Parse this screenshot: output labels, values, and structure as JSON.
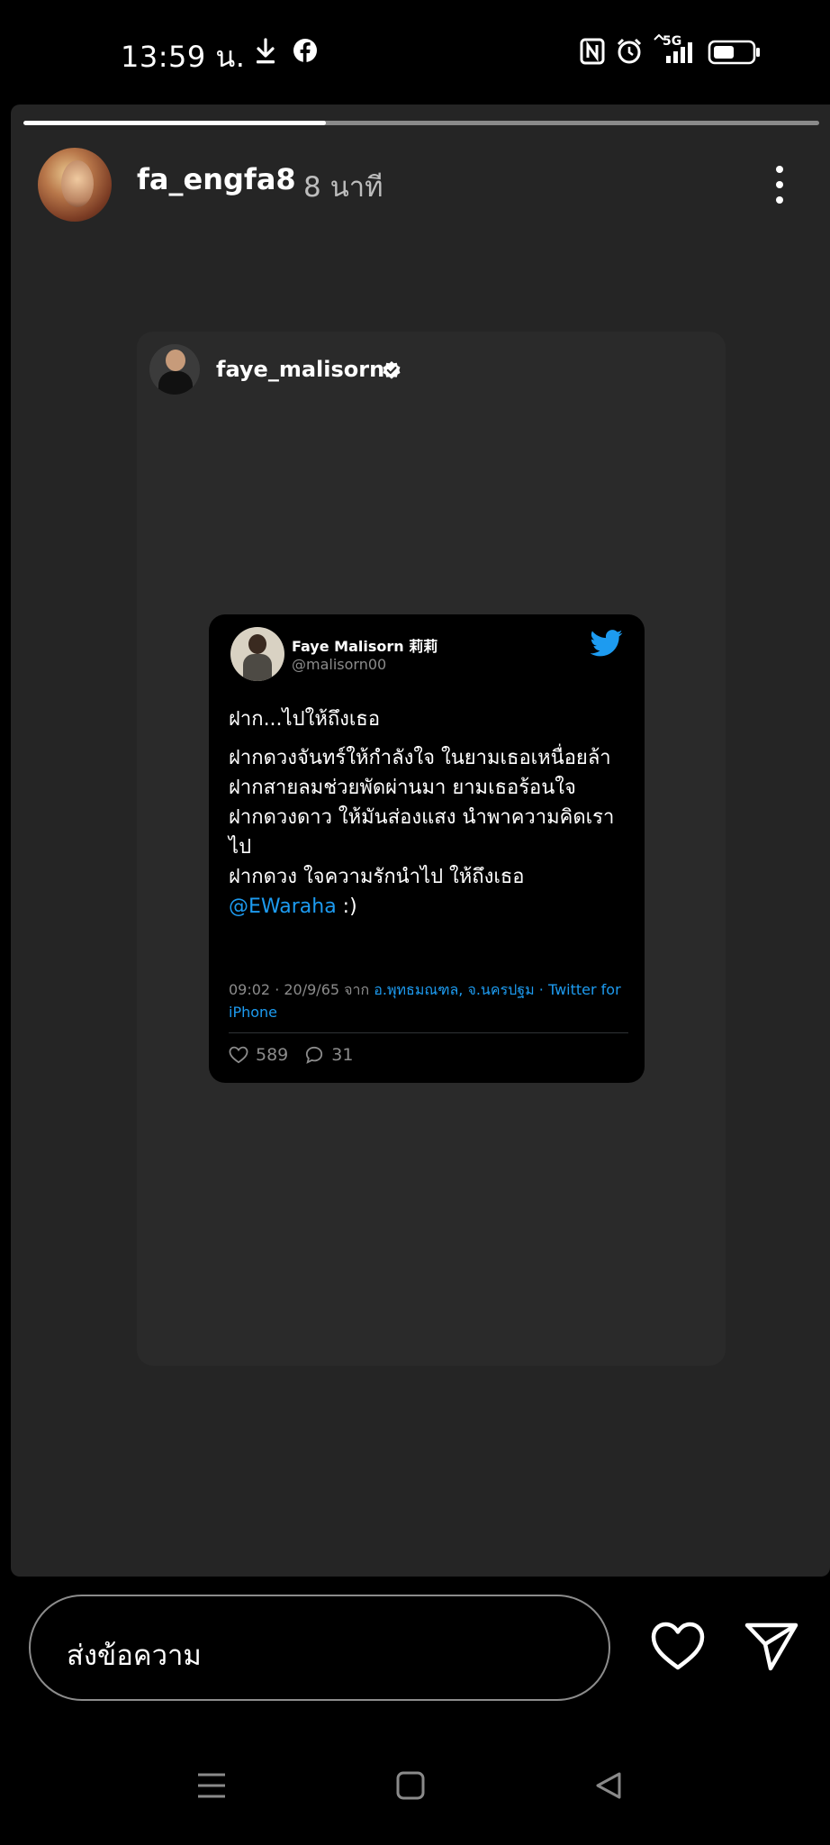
{
  "status_bar": {
    "time": "13:59 น.",
    "network": "5G",
    "icons": [
      "download-icon",
      "facebook-icon",
      "nfc-icon",
      "alarm-icon",
      "signal-icon",
      "battery-icon"
    ]
  },
  "story": {
    "progress": 0.38,
    "username": "fa_engfa8",
    "time_ago": "8 นาที"
  },
  "shared_post": {
    "username": "faye_malisorn"
  },
  "tweet": {
    "display_name": "Faye Malisorn 莉莉",
    "handle": "@malisorn00",
    "line1": "ฝาก...ไปให้ถึงเธอ",
    "line2": "ฝากดวงจันทร์ให้กำลังใจ ในยามเธอเหนื่อยล้า",
    "line3": "ฝากสายลมช่วยพัดผ่านมา ยามเธอร้อนใจ",
    "line4": "ฝากดวงดาว ให้มันส่องแสง นำพาความคิดเราไป",
    "line5": "ฝากดวง ใจความรักนำไป ให้ถึงเธอ",
    "mention": "@EWaraha",
    "emoticon": " :)",
    "meta_time": "09:02 · 20/9/65 จาก ",
    "meta_place": "อ.พุทธมณฑล, จ.นครปฐม · Twitter for iPhone",
    "likes": "589",
    "replies": "31"
  },
  "message_bar": {
    "placeholder": "ส่งข้อความ"
  },
  "colors": {
    "twitter_blue": "#1d9bf0",
    "panel_bg": "#252525"
  }
}
